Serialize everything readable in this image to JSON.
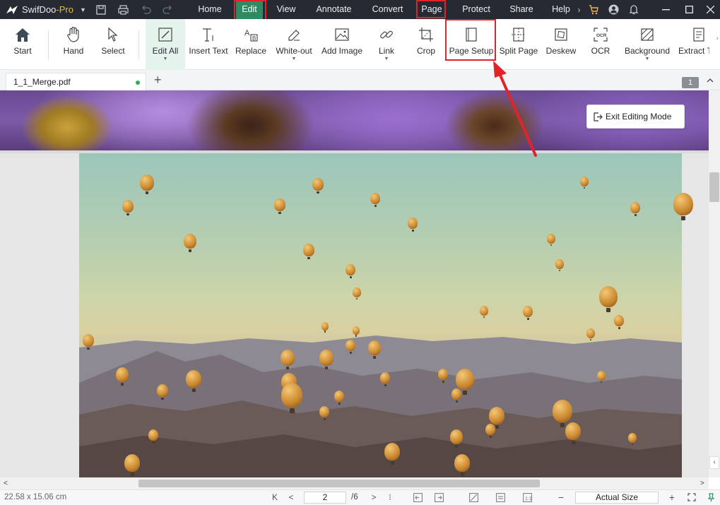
{
  "app": {
    "name": "SwifDoo",
    "suffix": "-Pro"
  },
  "menu": [
    {
      "label": "Home"
    },
    {
      "label": "Edit"
    },
    {
      "label": "View"
    },
    {
      "label": "Annotate"
    },
    {
      "label": "Convert"
    },
    {
      "label": "Page"
    },
    {
      "label": "Protect"
    },
    {
      "label": "Share"
    },
    {
      "label": "Help"
    }
  ],
  "menu_active": "Edit",
  "menu_highlighted": [
    "Edit",
    "Page"
  ],
  "ribbon": [
    {
      "label": "Start",
      "icon": "home-icon"
    },
    {
      "label": "Hand",
      "icon": "hand-icon"
    },
    {
      "label": "Select",
      "icon": "cursor-icon"
    },
    {
      "label": "Edit All",
      "icon": "edit-all-icon",
      "has_dropdown": true,
      "selected": true
    },
    {
      "label": "Insert Text",
      "icon": "insert-text-icon"
    },
    {
      "label": "Replace",
      "icon": "replace-icon"
    },
    {
      "label": "White-out",
      "icon": "eraser-icon",
      "has_dropdown": true
    },
    {
      "label": "Add Image",
      "icon": "image-icon"
    },
    {
      "label": "Link",
      "icon": "link-icon",
      "has_dropdown": true
    },
    {
      "label": "Crop",
      "icon": "crop-icon"
    },
    {
      "label": "Page Setup",
      "icon": "page-setup-icon",
      "highlighted": true
    },
    {
      "label": "Split Page",
      "icon": "split-page-icon"
    },
    {
      "label": "Deskew",
      "icon": "deskew-icon"
    },
    {
      "label": "OCR",
      "icon": "ocr-icon"
    },
    {
      "label": "Background",
      "icon": "background-icon",
      "has_dropdown": true
    },
    {
      "label": "Extract T",
      "icon": "extract-text-icon"
    }
  ],
  "tabs": [
    {
      "label": "1_1_Merge.pdf",
      "modified": true
    }
  ],
  "page_badge": "1",
  "exit_editing": {
    "label": "Exit Editing Mode"
  },
  "status": {
    "dimensions": "22.58 x 15.06 cm",
    "current_page": "2",
    "total_pages": "/6",
    "zoom": "Actual Size"
  },
  "colors": {
    "titlebar": "#252a33",
    "active_menu": "#2f8a63",
    "highlight": "#e0242a",
    "brand_pro": "#f1b63b",
    "ribbon_selected": "#e4f3ec",
    "modified_dot": "#28b25b"
  }
}
